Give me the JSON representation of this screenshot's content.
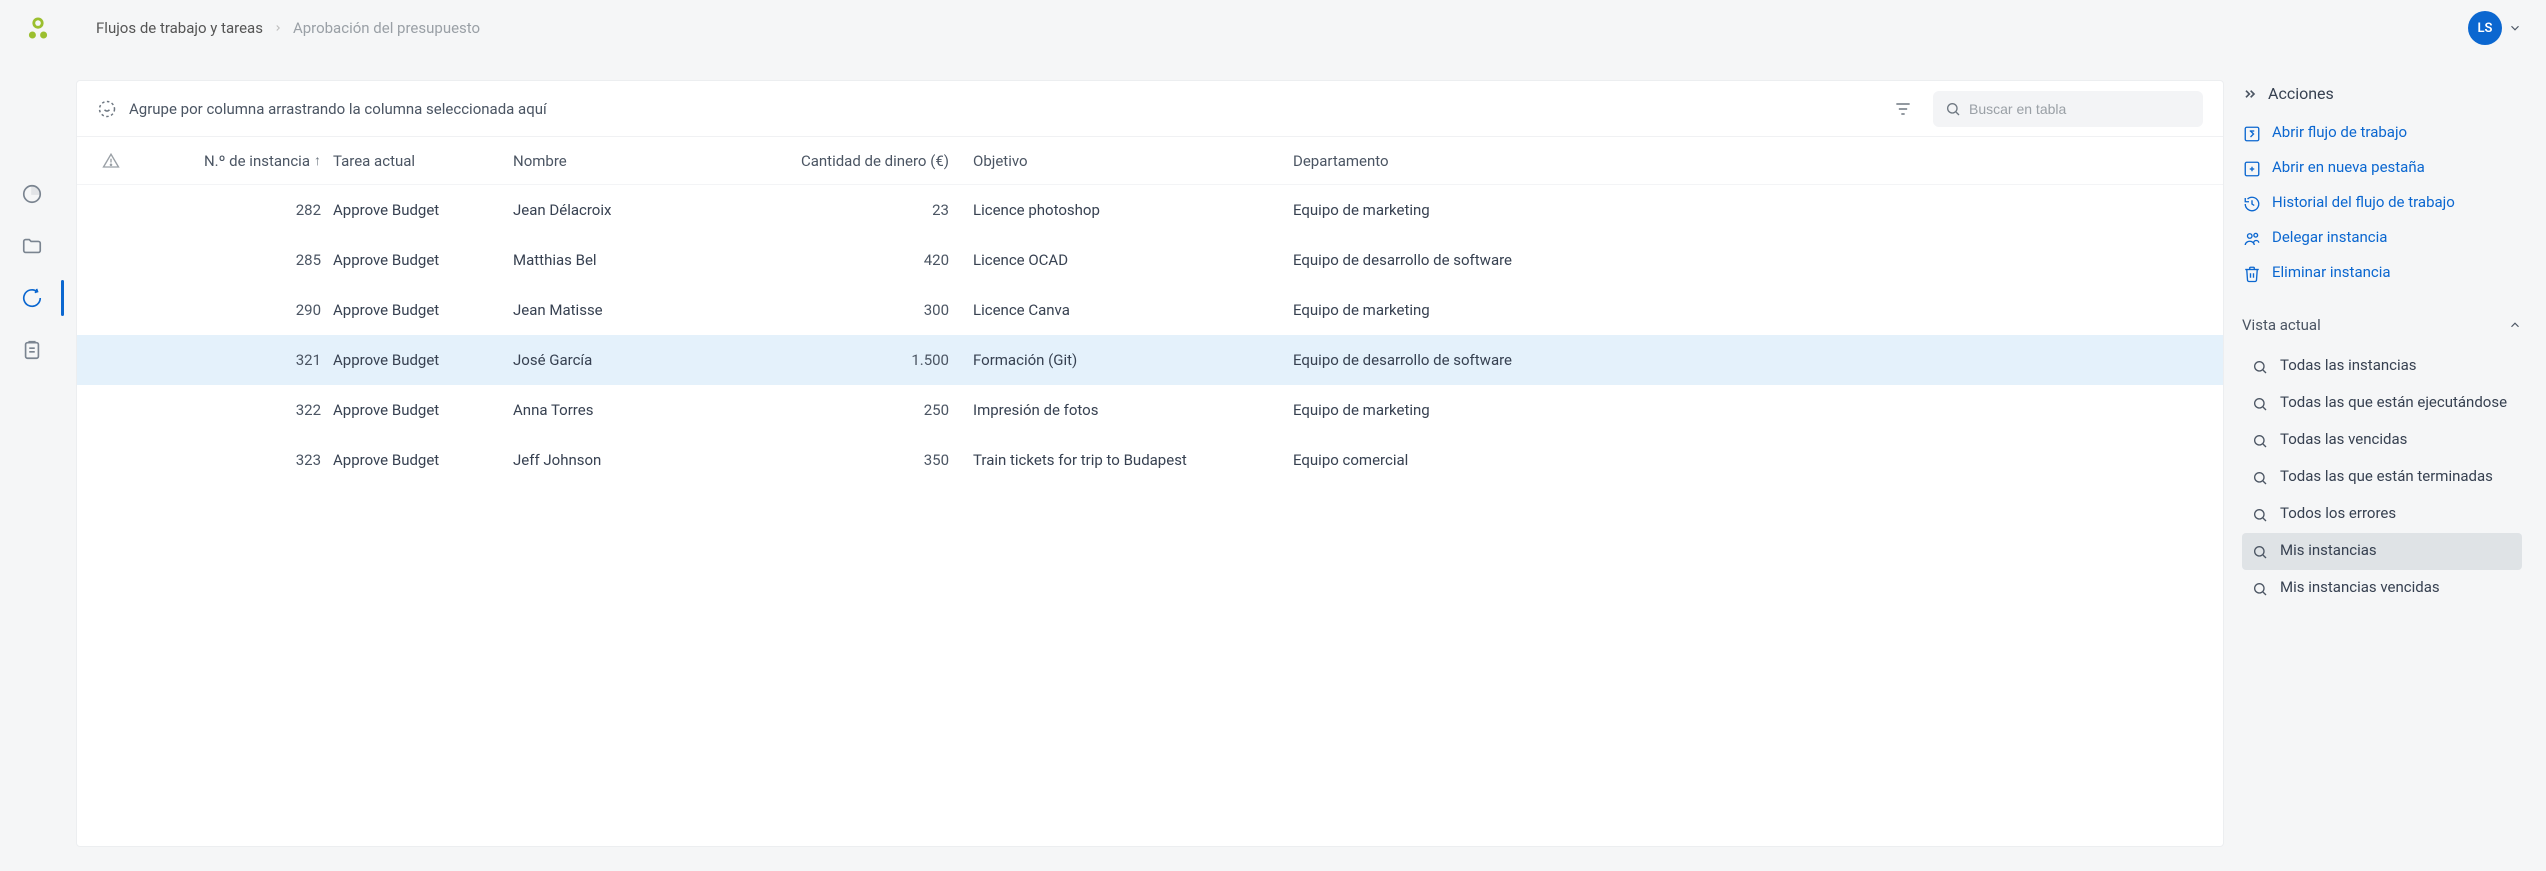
{
  "header": {
    "breadcrumb_root": "Flujos de trabajo y tareas",
    "breadcrumb_current": "Aprobación del presupuesto",
    "user_initials": "LS"
  },
  "toolbar": {
    "group_hint": "Agrupe por columna arrastrando la columna seleccionada aquí",
    "search_placeholder": "Buscar en tabla"
  },
  "table": {
    "columns": {
      "instance_no": "N.º de instancia",
      "task": "Tarea actual",
      "name": "Nombre",
      "amount": "Cantidad de dinero (€)",
      "goal": "Objetivo",
      "dept": "Departamento"
    },
    "rows": [
      {
        "id": "282",
        "task": "Approve Budget",
        "name": "Jean Délacroix",
        "amount": "23",
        "goal": "Licence photoshop",
        "dept": "Equipo de marketing",
        "selected": false
      },
      {
        "id": "285",
        "task": "Approve Budget",
        "name": "Matthias Bel",
        "amount": "420",
        "goal": "Licence OCAD",
        "dept": "Equipo de desarrollo de software",
        "selected": false
      },
      {
        "id": "290",
        "task": "Approve Budget",
        "name": "Jean Matisse",
        "amount": "300",
        "goal": "Licence Canva",
        "dept": "Equipo de marketing",
        "selected": false
      },
      {
        "id": "321",
        "task": "Approve Budget",
        "name": "José García",
        "amount": "1.500",
        "goal": "Formación (Git)",
        "dept": "Equipo de desarrollo de software",
        "selected": true
      },
      {
        "id": "322",
        "task": "Approve Budget",
        "name": "Anna Torres",
        "amount": "250",
        "goal": "Impresión de fotos",
        "dept": "Equipo de marketing",
        "selected": false
      },
      {
        "id": "323",
        "task": "Approve Budget",
        "name": "Jeff Johnson",
        "amount": "350",
        "goal": "Train tickets for trip to Budapest",
        "dept": "Equipo comercial",
        "selected": false
      }
    ]
  },
  "actions": {
    "title": "Acciones",
    "items": [
      {
        "label": "Abrir flujo de trabajo",
        "icon": "open-workflow-icon"
      },
      {
        "label": "Abrir en nueva pestaña",
        "icon": "new-tab-icon"
      },
      {
        "label": "Historial del flujo de trabajo",
        "icon": "history-icon"
      },
      {
        "label": "Delegar instancia",
        "icon": "delegate-icon"
      },
      {
        "label": "Eliminar instancia",
        "icon": "trash-icon"
      }
    ]
  },
  "views": {
    "title": "Vista actual",
    "items": [
      {
        "label": "Todas las instancias",
        "selected": false
      },
      {
        "label": "Todas las que están ejecutándose",
        "selected": false
      },
      {
        "label": "Todas las vencidas",
        "selected": false
      },
      {
        "label": "Todas las que están terminadas",
        "selected": false
      },
      {
        "label": "Todos los errores",
        "selected": false
      },
      {
        "label": "Mis instancias",
        "selected": true
      },
      {
        "label": "Mis instancias vencidas",
        "selected": false
      }
    ]
  }
}
